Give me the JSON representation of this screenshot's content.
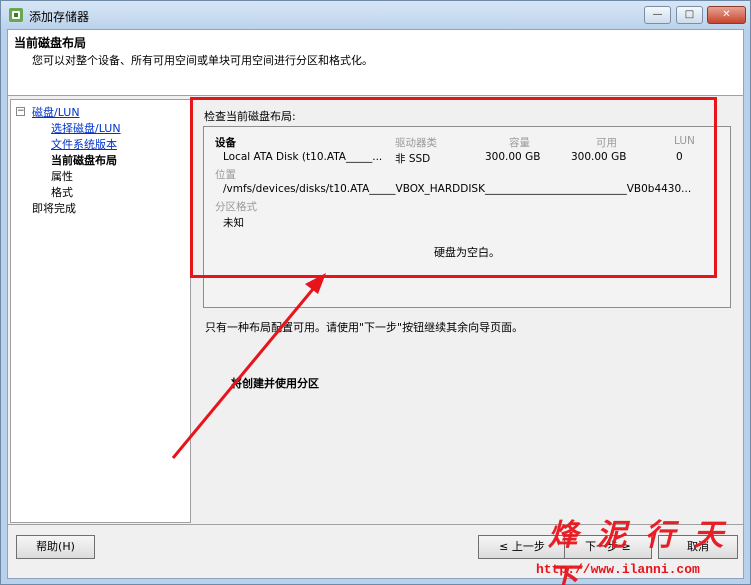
{
  "window": {
    "title": "添加存储器",
    "controls": {
      "minimize": "—",
      "maximize": "□",
      "close": "✕"
    }
  },
  "header": {
    "title": "当前磁盘布局",
    "subtitle": "您可以对整个设备、所有可用空间或单块可用空间进行分区和格式化。"
  },
  "steps": {
    "group": "磁盘/LUN",
    "items": [
      {
        "label": "选择磁盘/LUN"
      },
      {
        "label": "文件系统版本"
      },
      {
        "label": "当前磁盘布局"
      },
      {
        "label": "属性"
      },
      {
        "label": "格式"
      }
    ],
    "finish": "即将完成"
  },
  "main": {
    "review_label": "检查当前磁盘布局:",
    "columns": {
      "device": "设备",
      "drive_type": "驱动器类",
      "capacity": "容量",
      "available": "可用",
      "lun": "LUN"
    },
    "row": {
      "device": "Local ATA Disk (t10.ATA_____...",
      "drive_type": "非 SSD",
      "capacity": "300.00 GB",
      "available": "300.00 GB",
      "lun": "0"
    },
    "location_label": "位置",
    "location_value": "/vmfs/devices/disks/t10.ATA_____VBOX_HARDDISK___________________________VB0b4430...",
    "partition_label": "分区格式",
    "partition_value": "未知",
    "blank_message": "硬盘为空白。",
    "note": "只有一种布局配置可用。请使用\"下一步\"按钮继续其余向导页面。",
    "create_label": "将创建并使用分区"
  },
  "footer": {
    "help": "帮助(H)",
    "back": "≤ 上一步",
    "next": "下一步 ≥",
    "cancel": "取消"
  },
  "watermark": {
    "brand": "烽 泥 行 天下",
    "url": "http://www.ilanni.com"
  },
  "colors": {
    "annotation": "#e8141c",
    "link": "#0033cc"
  }
}
